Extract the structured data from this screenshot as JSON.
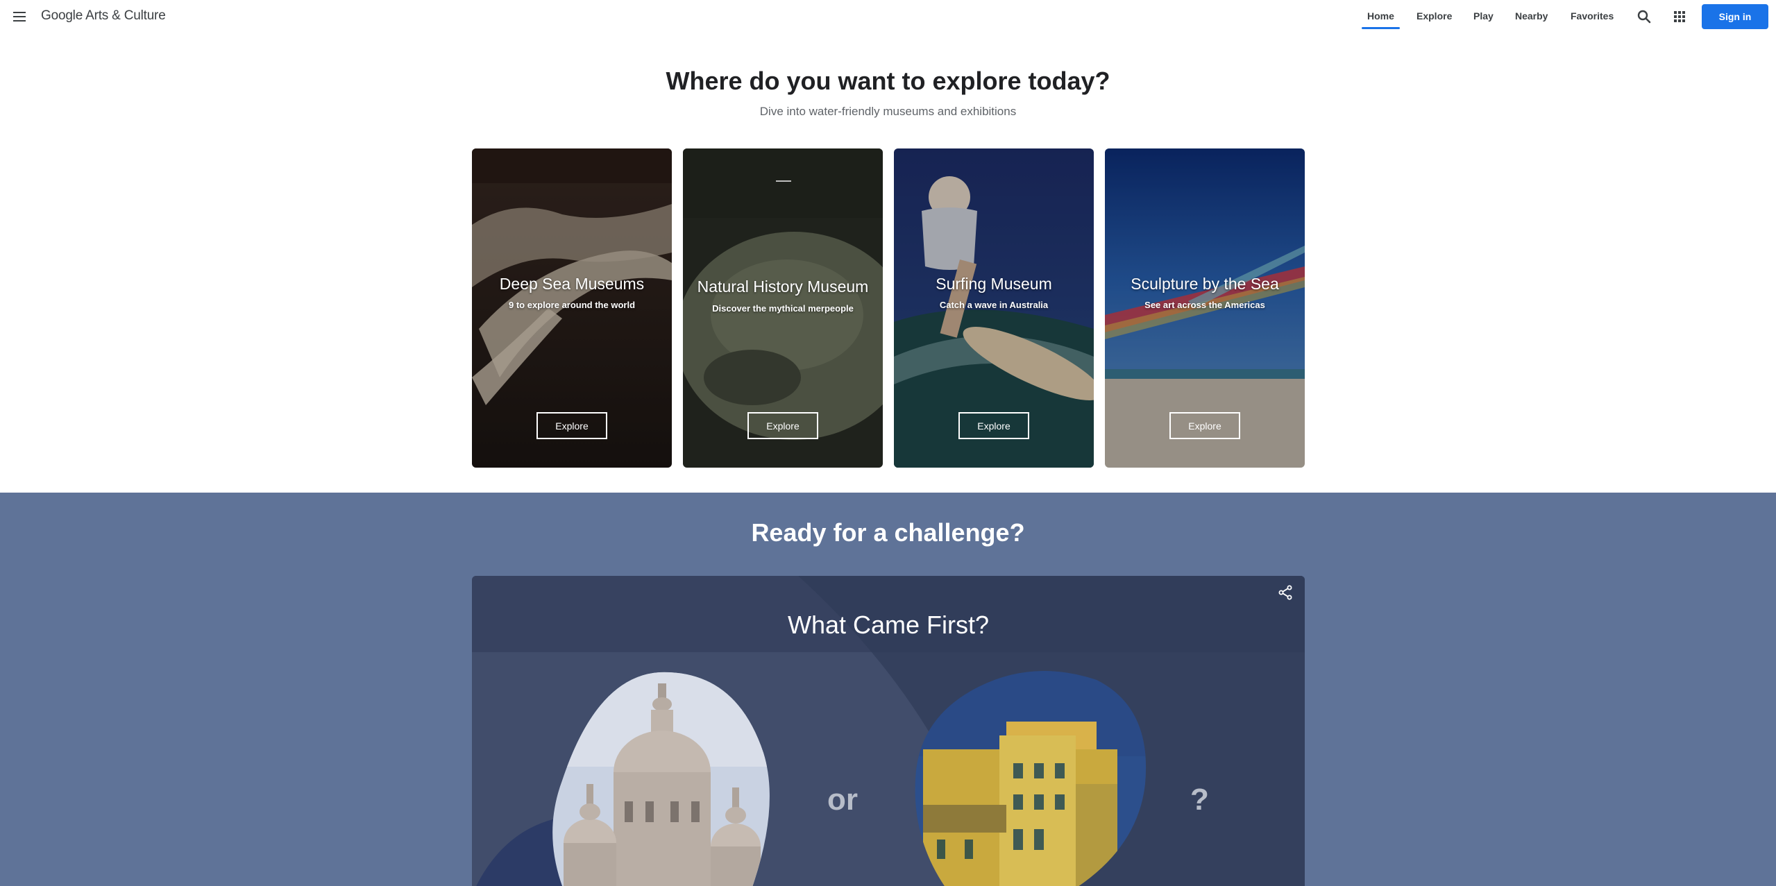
{
  "header": {
    "logo": "Google Arts & Culture",
    "nav": [
      "Home",
      "Explore",
      "Play",
      "Nearby",
      "Favorites"
    ],
    "active_nav": "Home",
    "sign_in": "Sign in",
    "icons": [
      "menu-icon",
      "search-icon",
      "apps-grid-icon"
    ]
  },
  "hero": {
    "title": "Where do you want to explore today?",
    "subtitle": "Dive into water-friendly museums and exhibitions"
  },
  "cards": [
    {
      "title": "Deep Sea Museums",
      "subtitle": "9 to explore around the world",
      "button": "Explore"
    },
    {
      "title": "Natural History Museum",
      "subtitle": "Discover the mythical merpeople",
      "button": "Explore"
    },
    {
      "title": "Surfing Museum",
      "subtitle": "Catch a wave in Australia",
      "button": "Explore"
    },
    {
      "title": "Sculpture by the Sea",
      "subtitle": "See art across the Americas",
      "button": "Explore"
    }
  ],
  "challenge": {
    "title": "Ready for a challenge?",
    "game_title": "What Came First?",
    "or_label": "or",
    "question_label": "?"
  },
  "colors": {
    "accent": "#1a73e8",
    "challenge_bg": "#5f7398",
    "game_bg": "#414d6b"
  }
}
